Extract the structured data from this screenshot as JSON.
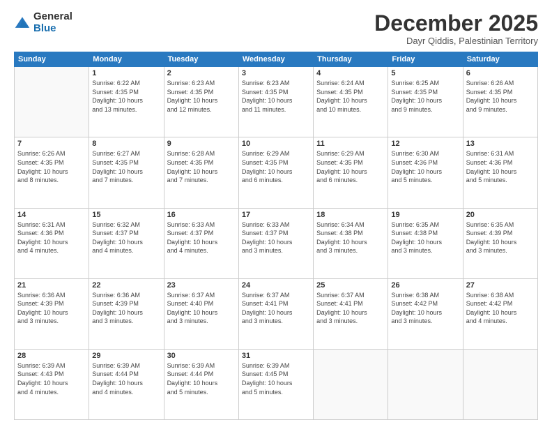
{
  "header": {
    "logo_general": "General",
    "logo_blue": "Blue",
    "title": "December 2025",
    "location": "Dayr Qiddis, Palestinian Territory"
  },
  "calendar": {
    "headers": [
      "Sunday",
      "Monday",
      "Tuesday",
      "Wednesday",
      "Thursday",
      "Friday",
      "Saturday"
    ],
    "rows": [
      [
        {
          "day": "",
          "info": ""
        },
        {
          "day": "1",
          "info": "Sunrise: 6:22 AM\nSunset: 4:35 PM\nDaylight: 10 hours\nand 13 minutes."
        },
        {
          "day": "2",
          "info": "Sunrise: 6:23 AM\nSunset: 4:35 PM\nDaylight: 10 hours\nand 12 minutes."
        },
        {
          "day": "3",
          "info": "Sunrise: 6:23 AM\nSunset: 4:35 PM\nDaylight: 10 hours\nand 11 minutes."
        },
        {
          "day": "4",
          "info": "Sunrise: 6:24 AM\nSunset: 4:35 PM\nDaylight: 10 hours\nand 10 minutes."
        },
        {
          "day": "5",
          "info": "Sunrise: 6:25 AM\nSunset: 4:35 PM\nDaylight: 10 hours\nand 9 minutes."
        },
        {
          "day": "6",
          "info": "Sunrise: 6:26 AM\nSunset: 4:35 PM\nDaylight: 10 hours\nand 9 minutes."
        }
      ],
      [
        {
          "day": "7",
          "info": "Sunrise: 6:26 AM\nSunset: 4:35 PM\nDaylight: 10 hours\nand 8 minutes."
        },
        {
          "day": "8",
          "info": "Sunrise: 6:27 AM\nSunset: 4:35 PM\nDaylight: 10 hours\nand 7 minutes."
        },
        {
          "day": "9",
          "info": "Sunrise: 6:28 AM\nSunset: 4:35 PM\nDaylight: 10 hours\nand 7 minutes."
        },
        {
          "day": "10",
          "info": "Sunrise: 6:29 AM\nSunset: 4:35 PM\nDaylight: 10 hours\nand 6 minutes."
        },
        {
          "day": "11",
          "info": "Sunrise: 6:29 AM\nSunset: 4:35 PM\nDaylight: 10 hours\nand 6 minutes."
        },
        {
          "day": "12",
          "info": "Sunrise: 6:30 AM\nSunset: 4:36 PM\nDaylight: 10 hours\nand 5 minutes."
        },
        {
          "day": "13",
          "info": "Sunrise: 6:31 AM\nSunset: 4:36 PM\nDaylight: 10 hours\nand 5 minutes."
        }
      ],
      [
        {
          "day": "14",
          "info": "Sunrise: 6:31 AM\nSunset: 4:36 PM\nDaylight: 10 hours\nand 4 minutes."
        },
        {
          "day": "15",
          "info": "Sunrise: 6:32 AM\nSunset: 4:37 PM\nDaylight: 10 hours\nand 4 minutes."
        },
        {
          "day": "16",
          "info": "Sunrise: 6:33 AM\nSunset: 4:37 PM\nDaylight: 10 hours\nand 4 minutes."
        },
        {
          "day": "17",
          "info": "Sunrise: 6:33 AM\nSunset: 4:37 PM\nDaylight: 10 hours\nand 3 minutes."
        },
        {
          "day": "18",
          "info": "Sunrise: 6:34 AM\nSunset: 4:38 PM\nDaylight: 10 hours\nand 3 minutes."
        },
        {
          "day": "19",
          "info": "Sunrise: 6:35 AM\nSunset: 4:38 PM\nDaylight: 10 hours\nand 3 minutes."
        },
        {
          "day": "20",
          "info": "Sunrise: 6:35 AM\nSunset: 4:39 PM\nDaylight: 10 hours\nand 3 minutes."
        }
      ],
      [
        {
          "day": "21",
          "info": "Sunrise: 6:36 AM\nSunset: 4:39 PM\nDaylight: 10 hours\nand 3 minutes."
        },
        {
          "day": "22",
          "info": "Sunrise: 6:36 AM\nSunset: 4:39 PM\nDaylight: 10 hours\nand 3 minutes."
        },
        {
          "day": "23",
          "info": "Sunrise: 6:37 AM\nSunset: 4:40 PM\nDaylight: 10 hours\nand 3 minutes."
        },
        {
          "day": "24",
          "info": "Sunrise: 6:37 AM\nSunset: 4:41 PM\nDaylight: 10 hours\nand 3 minutes."
        },
        {
          "day": "25",
          "info": "Sunrise: 6:37 AM\nSunset: 4:41 PM\nDaylight: 10 hours\nand 3 minutes."
        },
        {
          "day": "26",
          "info": "Sunrise: 6:38 AM\nSunset: 4:42 PM\nDaylight: 10 hours\nand 3 minutes."
        },
        {
          "day": "27",
          "info": "Sunrise: 6:38 AM\nSunset: 4:42 PM\nDaylight: 10 hours\nand 4 minutes."
        }
      ],
      [
        {
          "day": "28",
          "info": "Sunrise: 6:39 AM\nSunset: 4:43 PM\nDaylight: 10 hours\nand 4 minutes."
        },
        {
          "day": "29",
          "info": "Sunrise: 6:39 AM\nSunset: 4:44 PM\nDaylight: 10 hours\nand 4 minutes."
        },
        {
          "day": "30",
          "info": "Sunrise: 6:39 AM\nSunset: 4:44 PM\nDaylight: 10 hours\nand 5 minutes."
        },
        {
          "day": "31",
          "info": "Sunrise: 6:39 AM\nSunset: 4:45 PM\nDaylight: 10 hours\nand 5 minutes."
        },
        {
          "day": "",
          "info": ""
        },
        {
          "day": "",
          "info": ""
        },
        {
          "day": "",
          "info": ""
        }
      ]
    ]
  }
}
